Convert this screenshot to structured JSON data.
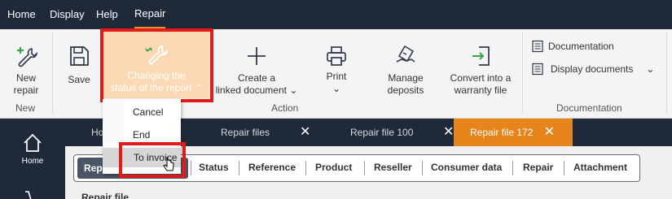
{
  "menu": {
    "items": [
      "Home",
      "Display",
      "Help",
      "Repair"
    ],
    "active": "Repair"
  },
  "ribbon": {
    "new_repair": "New repair",
    "new_repair_line1": "New",
    "new_repair_line2": "repair",
    "save": "Save",
    "changing_status_line1": "Changing the",
    "changing_status_line2": "status of the report",
    "create_linked_line1": "Create a",
    "create_linked_line2": "linked document",
    "print": "Print",
    "manage_deposits_line1": "Manage",
    "manage_deposits_line2": "deposits",
    "convert_line1": "Convert into a",
    "convert_line2": "warranty file",
    "documentation": "Documentation",
    "display_documents": "Display documents",
    "groups": {
      "new": "New",
      "action": "Action",
      "documentation": "Documentation"
    }
  },
  "dropdown": {
    "items": [
      "Cancel",
      "End",
      "To invoice"
    ],
    "hovered": "To invoice"
  },
  "leftnav": {
    "home": "Home"
  },
  "tabs": [
    {
      "label": "Ho",
      "closable": false
    },
    {
      "label": "Repair files",
      "closable": true
    },
    {
      "label": "Repair file 100",
      "closable": true
    },
    {
      "label": "Repair file 172",
      "closable": true,
      "active": true
    }
  ],
  "subtabs": [
    "Repair file summary",
    "Status",
    "Reference",
    "Product",
    "Reseller",
    "Consumer data",
    "Repair",
    "Attachment"
  ],
  "subtabs_visible": {
    "first_left": "Repai",
    "first_right": "umm"
  },
  "content": {
    "partial_heading": "Repair file"
  },
  "colors": {
    "dark_navy": "#1e2a3a",
    "accent_orange": "#e8841c",
    "highlight_peach": "#fbd9b4",
    "annotation_red": "#e11a1a",
    "icon_green": "#3aa54a"
  }
}
